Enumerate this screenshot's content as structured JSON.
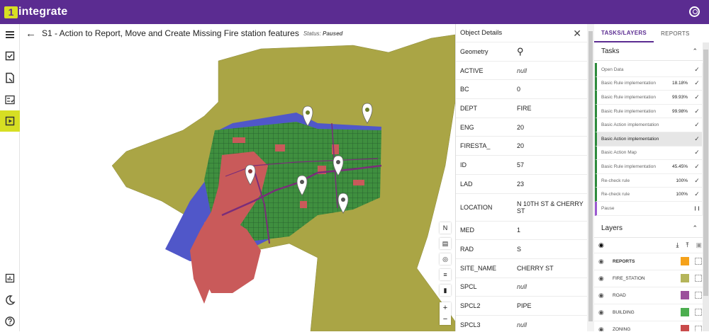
{
  "app": {
    "logo_mark": "1",
    "name": "integrate",
    "account_icon": "account-circle-icon",
    "brand_color": "#5b2c91",
    "accent_color": "#d7df23"
  },
  "leftnav": {
    "items": [
      "layers-icon",
      "task-check-icon",
      "report-file-icon",
      "rule-list-icon",
      "play-task-icon"
    ],
    "bottom": [
      "chart-icon",
      "moon-icon",
      "help-icon"
    ],
    "active": "play-task-icon"
  },
  "map": {
    "title": "S1 - Action to Report, Move and Create Missing Fire station features",
    "status_label": "Status:",
    "status_value": "Paused",
    "north_label": "N",
    "zoom_in": "+",
    "zoom_out": "−"
  },
  "details": {
    "title": "Object Details",
    "rows": [
      {
        "key": "Geometry",
        "value": ""
      },
      {
        "key": "ACTIVE",
        "value": "null",
        "null": true
      },
      {
        "key": "BC",
        "value": "0"
      },
      {
        "key": "DEPT",
        "value": "FIRE"
      },
      {
        "key": "ENG",
        "value": "20"
      },
      {
        "key": "FIRESTA_",
        "value": "20"
      },
      {
        "key": "ID",
        "value": "57"
      },
      {
        "key": "LAD",
        "value": "23"
      },
      {
        "key": "LOCATION",
        "value": "N 10TH ST & CHERRY ST"
      },
      {
        "key": "MED",
        "value": "1"
      },
      {
        "key": "RAD",
        "value": "S"
      },
      {
        "key": "SITE_NAME",
        "value": "CHERRY ST"
      },
      {
        "key": "SPCL",
        "value": "null",
        "null": true
      },
      {
        "key": "SPCL2",
        "value": "PIPE"
      },
      {
        "key": "SPCL3",
        "value": "null",
        "null": true
      }
    ]
  },
  "side": {
    "tabs": [
      "TASKS/LAYERS",
      "REPORTS"
    ],
    "tasks_title": "Tasks",
    "tasks": [
      {
        "name": "Open Data",
        "value": "",
        "icon": "check-icon"
      },
      {
        "name": "Basic Rule implementation",
        "value": "18.18%",
        "icon": "check-icon"
      },
      {
        "name": "Basic Rule implementation",
        "value": "99.93%",
        "icon": "check-icon"
      },
      {
        "name": "Basic Rule implementation",
        "value": "99.98%",
        "icon": "check-icon"
      },
      {
        "name": "Basic Action implementation",
        "value": "",
        "icon": "check-icon"
      },
      {
        "name": "Basic Action implementation",
        "value": "",
        "icon": "check-icon",
        "selected": true
      },
      {
        "name": "Basic Action Map",
        "value": "",
        "icon": "check-icon"
      },
      {
        "name": "Basic Rule implementation",
        "value": "45.45%",
        "icon": "check-icon"
      },
      {
        "name": "Re-check rule",
        "value": "100%",
        "icon": "check-icon"
      },
      {
        "name": "Re-check rule",
        "value": "100%",
        "icon": "check-icon"
      },
      {
        "name": "Pause",
        "value": "",
        "icon": "pause-icon",
        "purple": true
      }
    ],
    "layers_title": "Layers",
    "layers": [
      {
        "name": "REPORTS",
        "color": "#f5a21b",
        "bold": true
      },
      {
        "name": "FIRE_STATION",
        "color": "#b5b55a"
      },
      {
        "name": "ROAD",
        "color": "#9b4f9b"
      },
      {
        "name": "BUILDING",
        "color": "#4cae4f"
      },
      {
        "name": "ZONING",
        "color": "#c94a4a"
      }
    ]
  }
}
